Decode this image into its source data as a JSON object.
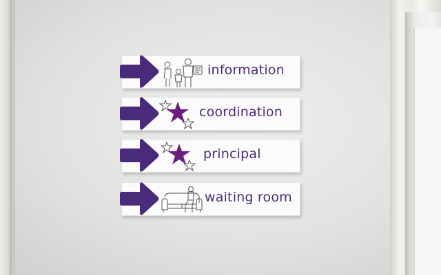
{
  "colors": {
    "arrow": "#4a2a7a",
    "text": "#4b2a73",
    "star": "#6a1f7d",
    "sign": "#fbfbfb"
  },
  "signs": [
    {
      "label": "information",
      "icon": "family-icon"
    },
    {
      "label": "coordination",
      "icon": "stars-icon"
    },
    {
      "label": "principal",
      "icon": "stars-icon"
    },
    {
      "label": "waiting room",
      "icon": "sofa-icon"
    }
  ]
}
